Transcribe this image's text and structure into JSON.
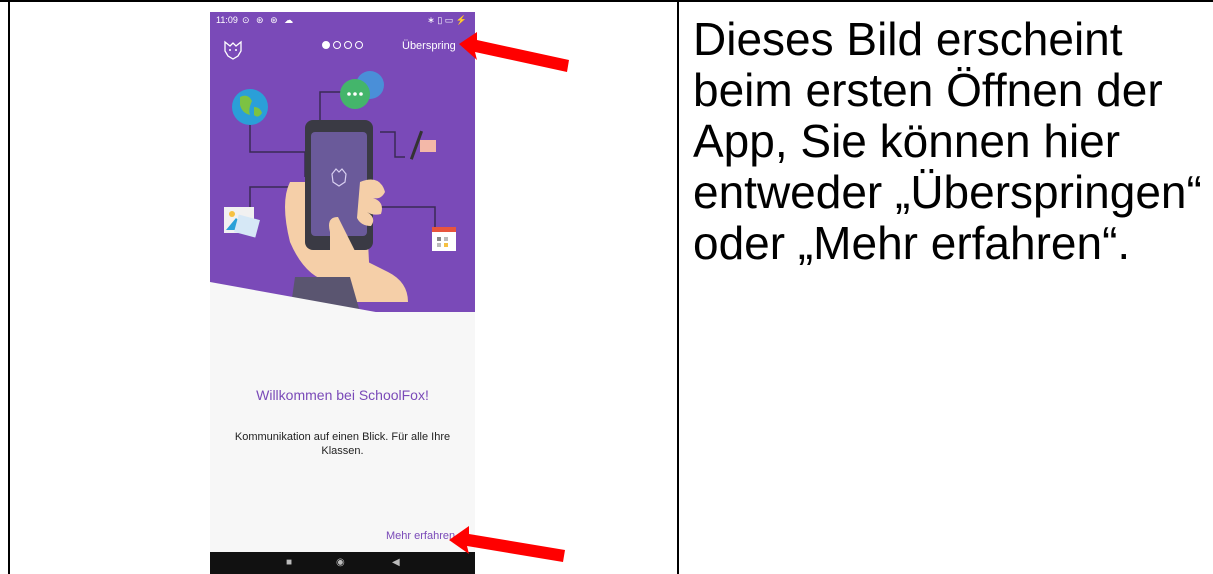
{
  "phone": {
    "status": {
      "time": "11:09",
      "left_icons": "⊙ ⊛ ⊛ ☁",
      "right_icons": "∗ ▯ ▭ ⚡"
    },
    "onboarding": {
      "skip_label": "Überspring",
      "page_indicator": {
        "current": 1,
        "total": 4
      },
      "welcome_title": "Willkommen bei SchoolFox!",
      "description": "Kommunikation auf einen Blick. Für alle Ihre Klassen.",
      "more_label": "Mehr erfahren"
    },
    "navbar": {
      "square": "■",
      "circle": "◉",
      "back": "◀"
    },
    "colors": {
      "brand": "#7a4ab8",
      "arrow": "#ff0000"
    }
  },
  "explanation": "Dieses Bild erscheint beim ersten Öffnen der App, Sie können hier entweder „Überspringen“ oder „Mehr erfahren“."
}
